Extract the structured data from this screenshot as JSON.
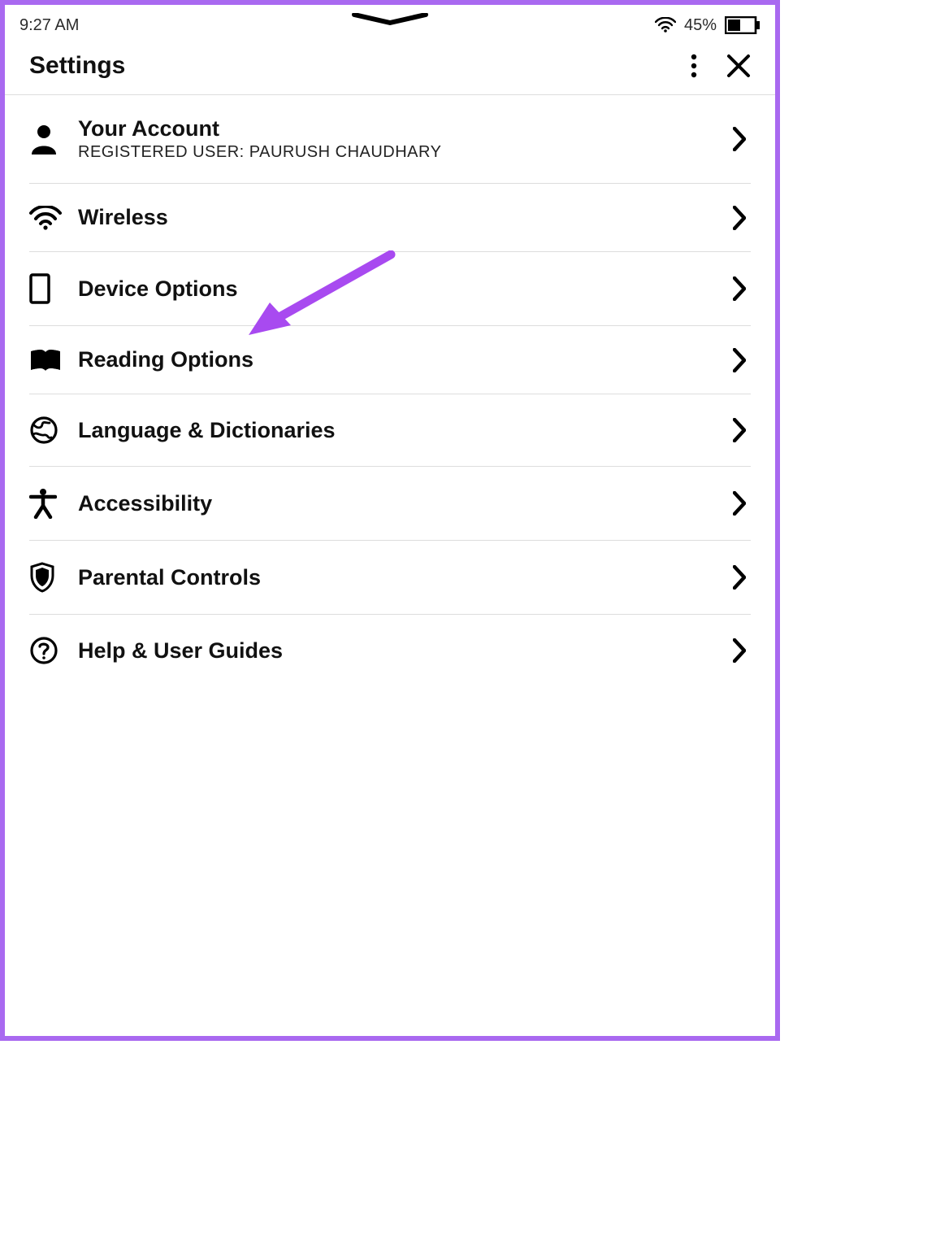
{
  "status_bar": {
    "time": "9:27 AM",
    "battery_pct": "45%"
  },
  "header": {
    "title": "Settings"
  },
  "settings": {
    "items": [
      {
        "label": "Your Account",
        "subtitle": "REGISTERED USER: PAURUSH CHAUDHARY"
      },
      {
        "label": "Wireless"
      },
      {
        "label": "Device Options"
      },
      {
        "label": "Reading Options"
      },
      {
        "label": "Language & Dictionaries"
      },
      {
        "label": "Accessibility"
      },
      {
        "label": "Parental Controls"
      },
      {
        "label": "Help & User Guides"
      }
    ]
  },
  "annotation": {
    "color": "#a84af0"
  }
}
